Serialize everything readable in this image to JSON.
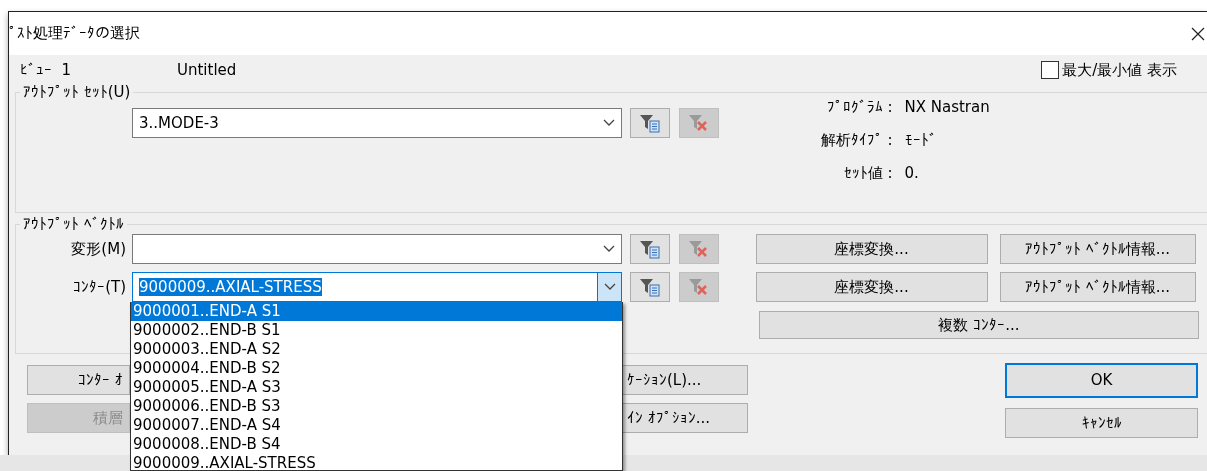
{
  "window": {
    "title": "ﾟｽﾄ処理ﾃﾞｰﾀの選択"
  },
  "view": {
    "label": "ﾋﾞｭｰ",
    "number": "1",
    "name": "Untitled"
  },
  "minmax_checkbox": {
    "label": "最大/最小値 表示",
    "checked": false
  },
  "output_set": {
    "legend": "ｱｳﾄﾌﾟｯﾄ ｾｯﾄ(U)",
    "value": "3..MODE-3",
    "focused": false,
    "clear_disabled": true,
    "info": [
      {
        "label": "ﾌﾟﾛｸﾞﾗﾑ :",
        "value": "NX Nastran"
      },
      {
        "label": "解析ﾀｲﾌﾟ :",
        "value": "ﾓｰﾄﾞ"
      },
      {
        "label": "ｾｯﾄ値 :",
        "value": "0."
      }
    ]
  },
  "output_vector": {
    "legend": "ｱｳﾄﾌﾟｯﾄ ﾍﾞｸﾄﾙ",
    "rows": [
      {
        "label": "変形(M)",
        "focused": false,
        "clear_disabled": true,
        "buttons": [
          "座標変換...",
          "ｱｳﾄﾌﾟｯﾄ ﾍﾞｸﾄﾙ情報..."
        ]
      },
      {
        "label": "ｺﾝﾀｰ(T)",
        "value": "9000009..AXIAL-STRESS",
        "focused": true,
        "clear_disabled": true,
        "buttons": [
          "座標変換...",
          "ｱｳﾄﾌﾟｯﾄ ﾍﾞｸﾄﾙ情報..."
        ]
      }
    ],
    "multi_button": "複数 ｺﾝﾀｰ..."
  },
  "bottom_buttons": [
    {
      "label": "ｺﾝﾀｰ ｵ",
      "disabled": false
    },
    {
      "label": "ｹｰｼｮﾝ(L)...",
      "disabled": false
    },
    {
      "label": "積層",
      "disabled": true
    },
    {
      "label": "ｲﾝ ｵﾌﾟｼｮﾝ...",
      "disabled": false
    }
  ],
  "dialog_buttons": [
    {
      "label": "OK",
      "default": true
    },
    {
      "label": "ｷｬﾝｾﾙ",
      "default": false
    }
  ],
  "dropdown": {
    "items": [
      {
        "text": "9000001..END-A S1",
        "selected": true
      },
      {
        "text": "9000002..END-B S1",
        "selected": false
      },
      {
        "text": "9000003..END-A S2",
        "selected": false
      },
      {
        "text": "9000004..END-B S2",
        "selected": false
      },
      {
        "text": "9000005..END-A S3",
        "selected": false
      },
      {
        "text": "9000006..END-B S3",
        "selected": false
      },
      {
        "text": "9000007..END-A S4",
        "selected": false
      },
      {
        "text": "9000008..END-B S4",
        "selected": false
      },
      {
        "text": "9000009..AXIAL-STRESS",
        "selected": false
      }
    ]
  }
}
